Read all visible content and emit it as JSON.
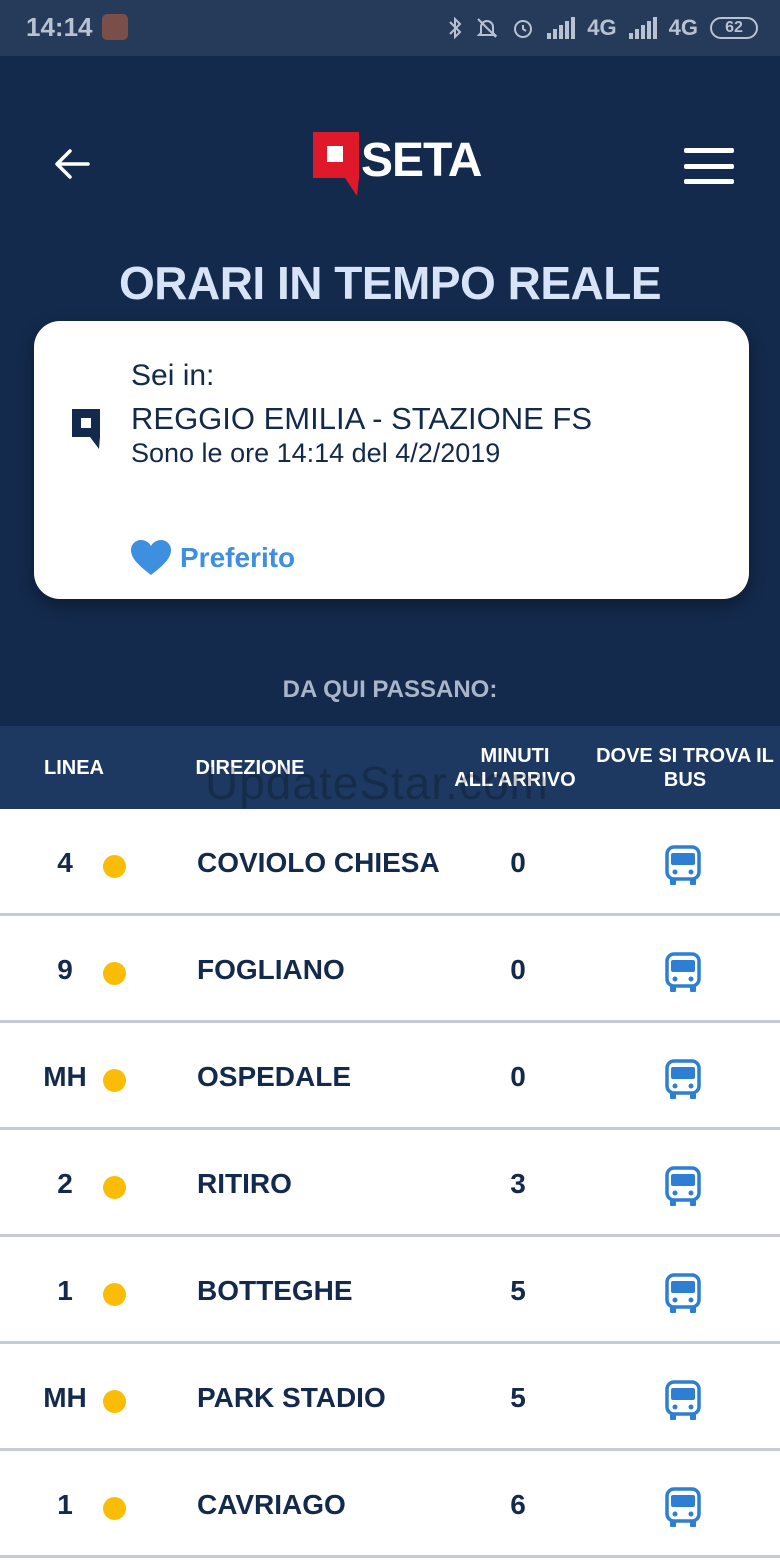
{
  "status_bar": {
    "time": "14:14",
    "network1": "4G",
    "network2": "4G",
    "battery": "62"
  },
  "header": {
    "logo_text": "SETA",
    "title": "ORARI IN TEMPO REALE"
  },
  "stop_card": {
    "location_label": "Sei in:",
    "stop_name": "REGGIO EMILIA - STAZIONE FS",
    "time_text": "Sono le ore 14:14 del 4/2/2019",
    "favorite_label": "Preferito"
  },
  "section_label": "DA QUI PASSANO:",
  "table": {
    "headers": {
      "linea": "LINEA",
      "direzione": "DIREZIONE",
      "minuti": "MINUTI ALL'ARRIVO",
      "dove": "DOVE SI TROVA IL BUS"
    },
    "rows": [
      {
        "line": "4",
        "direction": "COVIOLO CHIESA",
        "minutes": "0"
      },
      {
        "line": "9",
        "direction": "FOGLIANO",
        "minutes": "0"
      },
      {
        "line": "MH",
        "direction": "OSPEDALE",
        "minutes": "0"
      },
      {
        "line": "2",
        "direction": "RITIRO",
        "minutes": "3"
      },
      {
        "line": "1",
        "direction": "BOTTEGHE",
        "minutes": "5"
      },
      {
        "line": "MH",
        "direction": "PARK STADIO",
        "minutes": "5"
      },
      {
        "line": "1",
        "direction": "CAVRIAGO",
        "minutes": "6"
      }
    ]
  },
  "watermark": "UpdateStar.com",
  "icons": {
    "back": "arrow-left-icon",
    "menu": "hamburger-menu-icon",
    "stop": "stop-pin-icon",
    "favorite": "heart-icon",
    "bus": "bus-icon"
  },
  "colors": {
    "header_bg": "#132a4c",
    "table_header_bg": "#1d3961",
    "accent_blue": "#3f8fe0",
    "status_dot": "#fbbc05",
    "logo_red": "#e0192a"
  }
}
